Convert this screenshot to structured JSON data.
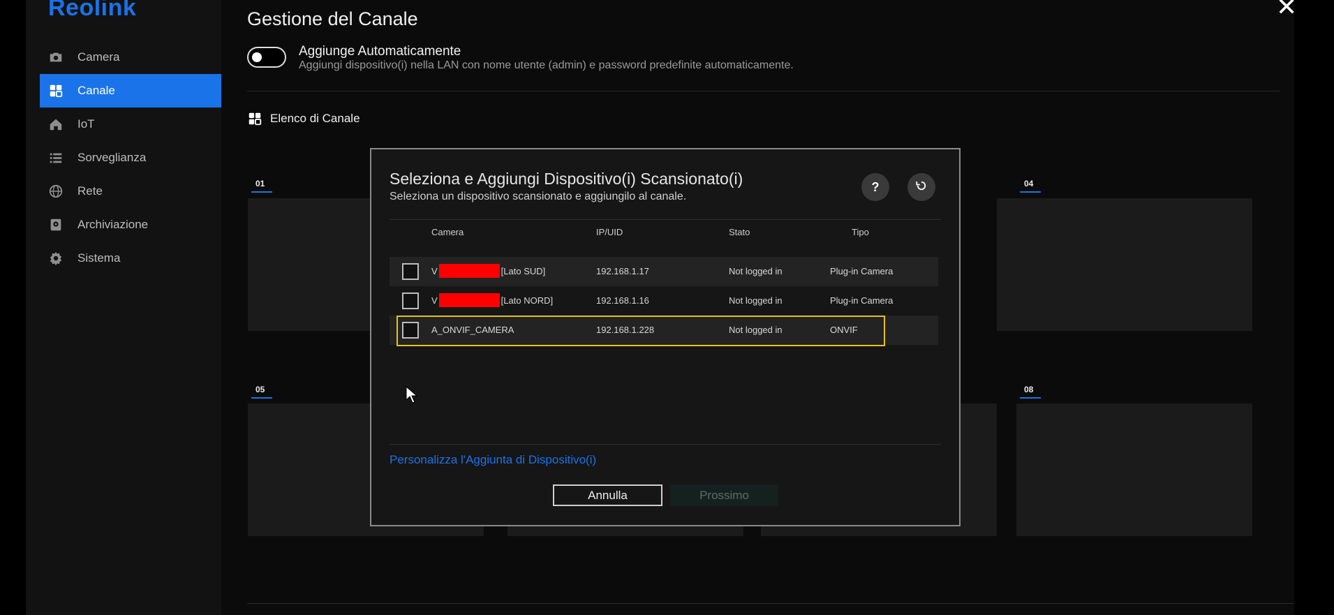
{
  "app": {
    "logo": "Reolink",
    "close_icon": "close-icon"
  },
  "sidebar": {
    "items": [
      {
        "label": "Camera",
        "icon": "camera-icon",
        "active": false
      },
      {
        "label": "Canale",
        "icon": "grid-icon",
        "active": true
      },
      {
        "label": "IoT",
        "icon": "home-icon",
        "active": false
      },
      {
        "label": "Sorveglianza",
        "icon": "list-icon",
        "active": false
      },
      {
        "label": "Rete",
        "icon": "globe-icon",
        "active": false
      },
      {
        "label": "Archiviazione",
        "icon": "storage-icon",
        "active": false
      },
      {
        "label": "Sistema",
        "icon": "gear-icon",
        "active": false
      }
    ]
  },
  "main": {
    "title": "Gestione del Canale",
    "auto_add": {
      "title": "Aggiunge Automaticamente",
      "description": "Aggiungi dispositivo(i) nella LAN con nome utente (admin) e password predefinite automaticamente.",
      "enabled": false
    },
    "list_title": "Elenco di Canale",
    "tiles": [
      "01",
      "04",
      "05",
      "08"
    ]
  },
  "modal": {
    "title": "Seleziona e Aggiungi Dispositivo(i) Scansionato(i)",
    "subtitle": "Seleziona un dispositivo scansionato e aggiungilo al canale.",
    "help_label": "?",
    "columns": [
      "Camera",
      "IP/UID",
      "Stato",
      "Tipo"
    ],
    "rows": [
      {
        "name_prefix": "V",
        "name_suffix": "[Lato SUD]",
        "ip": "192.168.1.17",
        "status": "Not logged in",
        "type": "Plug-in Camera",
        "redacted": true,
        "checked": false
      },
      {
        "name_prefix": "V",
        "name_suffix": "[Lato NORD]",
        "ip": "192.168.1.16",
        "status": "Not logged in",
        "type": "Plug-in Camera",
        "redacted": true,
        "checked": false
      },
      {
        "name_prefix": "A_ONVIF_CAMERA",
        "name_suffix": "",
        "ip": "192.168.1.228",
        "status": "Not logged in",
        "type": "ONVIF",
        "redacted": false,
        "checked": false
      }
    ],
    "custom_link": "Personalizza l'Aggiunta di Dispositivo(i)",
    "cancel_label": "Annulla",
    "next_label": "Prossimo",
    "colors": {
      "accent": "#1a73e8",
      "highlight": "#e8c21c"
    }
  }
}
